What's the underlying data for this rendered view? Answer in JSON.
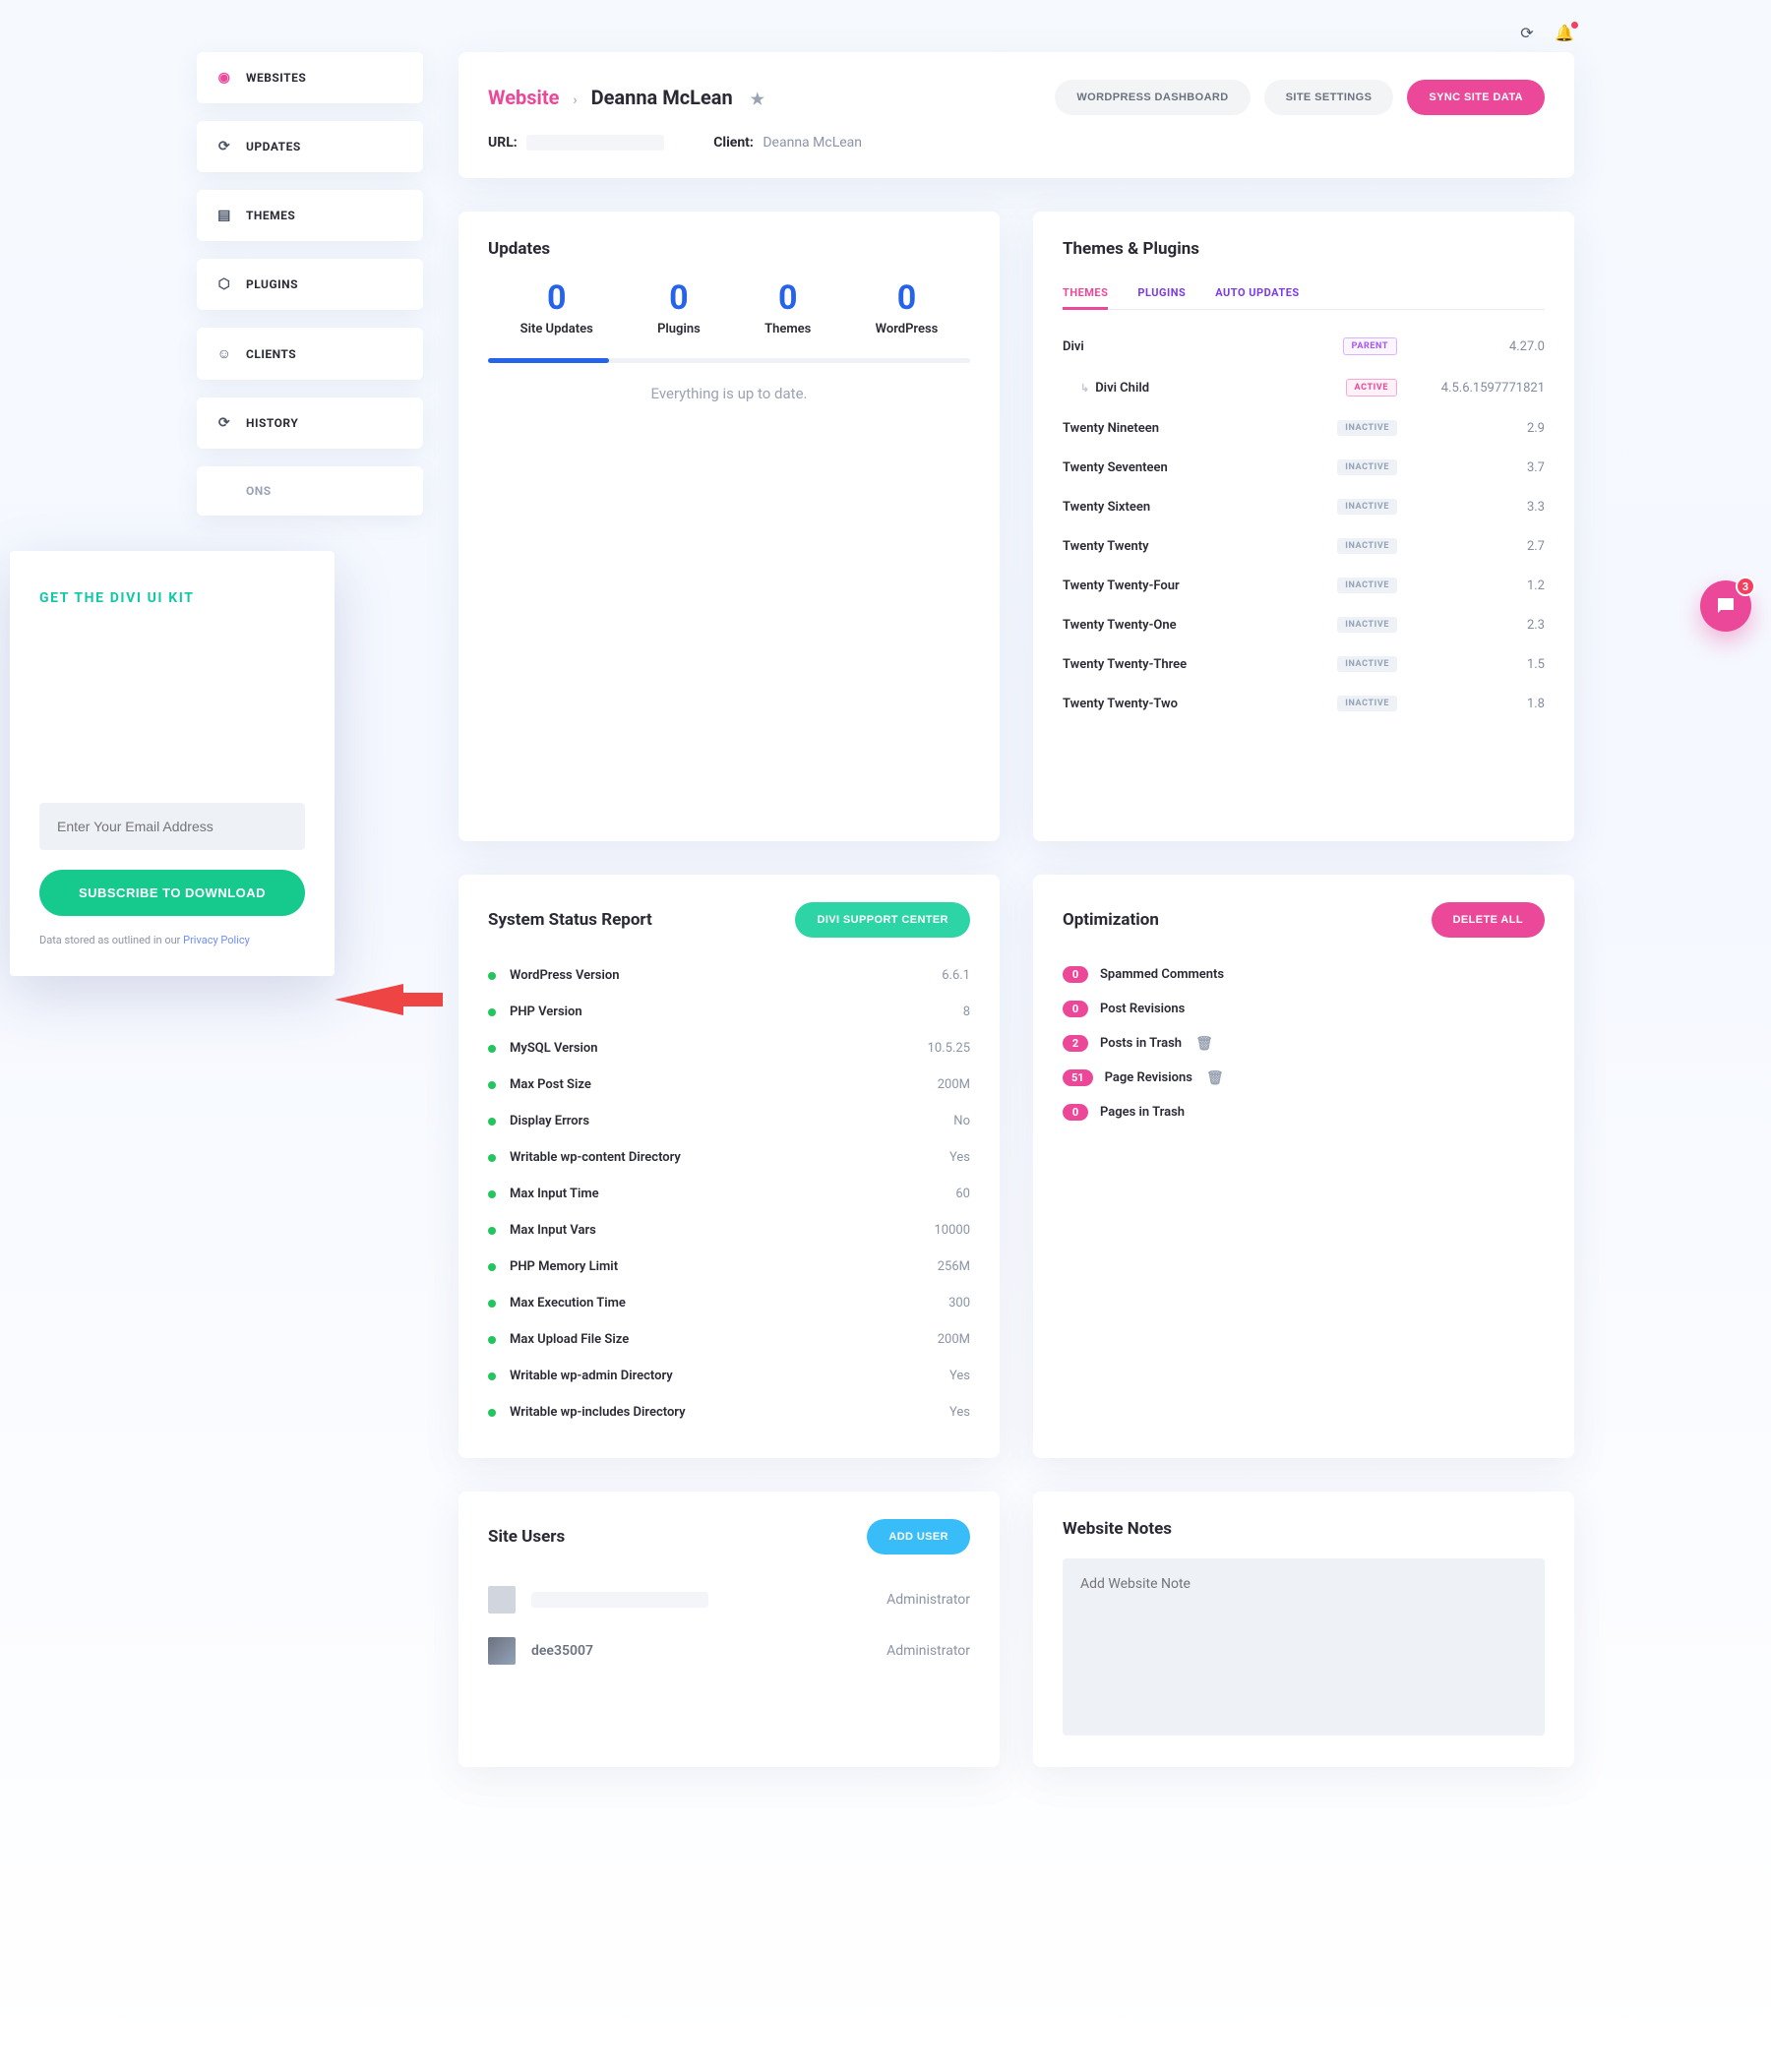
{
  "topIcons": {
    "refresh": "refresh",
    "bell": "notifications"
  },
  "sidebar": {
    "items": [
      {
        "label": "WEBSITES",
        "icon": "●"
      },
      {
        "label": "UPDATES",
        "icon": "⟳"
      },
      {
        "label": "THEMES",
        "icon": "▤"
      },
      {
        "label": "PLUGINS",
        "icon": "⬡"
      },
      {
        "label": "CLIENTS",
        "icon": "👤"
      },
      {
        "label": "HISTORY",
        "icon": "⟳"
      },
      {
        "label": "ONS",
        "icon": ""
      }
    ]
  },
  "header": {
    "breadcrumb_root": "Website",
    "breadcrumb_current": "Deanna McLean",
    "url_label": "URL:",
    "client_label": "Client:",
    "client_value": "Deanna McLean",
    "actions": {
      "dashboard": "WORDPRESS DASHBOARD",
      "settings": "SITE SETTINGS",
      "sync": "SYNC SITE DATA"
    }
  },
  "updates": {
    "title": "Updates",
    "items": [
      {
        "count": "0",
        "label": "Site Updates"
      },
      {
        "count": "0",
        "label": "Plugins"
      },
      {
        "count": "0",
        "label": "Themes"
      },
      {
        "count": "0",
        "label": "WordPress"
      }
    ],
    "message": "Everything is up to date."
  },
  "themes": {
    "title": "Themes & Plugins",
    "tabs": {
      "themes": "THEMES",
      "plugins": "PLUGINS",
      "auto": "AUTO UPDATES"
    },
    "rows": [
      {
        "name": "Divi",
        "badge": "PARENT",
        "badgeClass": "badge-parent",
        "version": "4.27.0"
      },
      {
        "name": "Divi Child",
        "child": true,
        "badge": "ACTIVE",
        "badgeClass": "badge-active",
        "version": "4.5.6.1597771821"
      },
      {
        "name": "Twenty Nineteen",
        "badge": "INACTIVE",
        "badgeClass": "badge-inactive",
        "version": "2.9"
      },
      {
        "name": "Twenty Seventeen",
        "badge": "INACTIVE",
        "badgeClass": "badge-inactive",
        "version": "3.7"
      },
      {
        "name": "Twenty Sixteen",
        "badge": "INACTIVE",
        "badgeClass": "badge-inactive",
        "version": "3.3"
      },
      {
        "name": "Twenty Twenty",
        "badge": "INACTIVE",
        "badgeClass": "badge-inactive",
        "version": "2.7"
      },
      {
        "name": "Twenty Twenty-Four",
        "badge": "INACTIVE",
        "badgeClass": "badge-inactive",
        "version": "1.2"
      },
      {
        "name": "Twenty Twenty-One",
        "badge": "INACTIVE",
        "badgeClass": "badge-inactive",
        "version": "2.3"
      },
      {
        "name": "Twenty Twenty-Three",
        "badge": "INACTIVE",
        "badgeClass": "badge-inactive",
        "version": "1.5"
      },
      {
        "name": "Twenty Twenty-Two",
        "badge": "INACTIVE",
        "badgeClass": "badge-inactive",
        "version": "1.8"
      }
    ]
  },
  "system": {
    "title": "System Status Report",
    "button": "DIVI SUPPORT CENTER",
    "rows": [
      {
        "name": "WordPress Version",
        "value": "6.6.1"
      },
      {
        "name": "PHP Version",
        "value": "8"
      },
      {
        "name": "MySQL Version",
        "value": "10.5.25"
      },
      {
        "name": "Max Post Size",
        "value": "200M"
      },
      {
        "name": "Display Errors",
        "value": "No"
      },
      {
        "name": "Writable wp-content Directory",
        "value": "Yes"
      },
      {
        "name": "Max Input Time",
        "value": "60"
      },
      {
        "name": "Max Input Vars",
        "value": "10000"
      },
      {
        "name": "PHP Memory Limit",
        "value": "256M"
      },
      {
        "name": "Max Execution Time",
        "value": "300"
      },
      {
        "name": "Max Upload File Size",
        "value": "200M"
      },
      {
        "name": "Writable wp-admin Directory",
        "value": "Yes"
      },
      {
        "name": "Writable wp-includes Directory",
        "value": "Yes"
      }
    ]
  },
  "optimization": {
    "title": "Optimization",
    "button": "DELETE ALL",
    "rows": [
      {
        "count": "0",
        "label": "Spammed Comments"
      },
      {
        "count": "0",
        "label": "Post Revisions"
      },
      {
        "count": "2",
        "label": "Posts in Trash",
        "trash": true
      },
      {
        "count": "51",
        "label": "Page Revisions",
        "trash": true
      },
      {
        "count": "0",
        "label": "Pages in Trash"
      }
    ]
  },
  "siteUsers": {
    "title": "Site Users",
    "button": "ADD USER",
    "rows": [
      {
        "name": "",
        "role": "Administrator",
        "blur": true
      },
      {
        "name": "dee35007",
        "role": "Administrator"
      }
    ]
  },
  "notes": {
    "title": "Website Notes",
    "placeholder": "Add Website Note"
  },
  "promo": {
    "title": "GET THE DIVI UI KIT",
    "placeholder": "Enter Your Email Address",
    "button": "SUBSCRIBE TO DOWNLOAD",
    "legal_prefix": "Data stored as outlined in our ",
    "legal_link": "Privacy Policy"
  },
  "chat": {
    "count": "3"
  }
}
